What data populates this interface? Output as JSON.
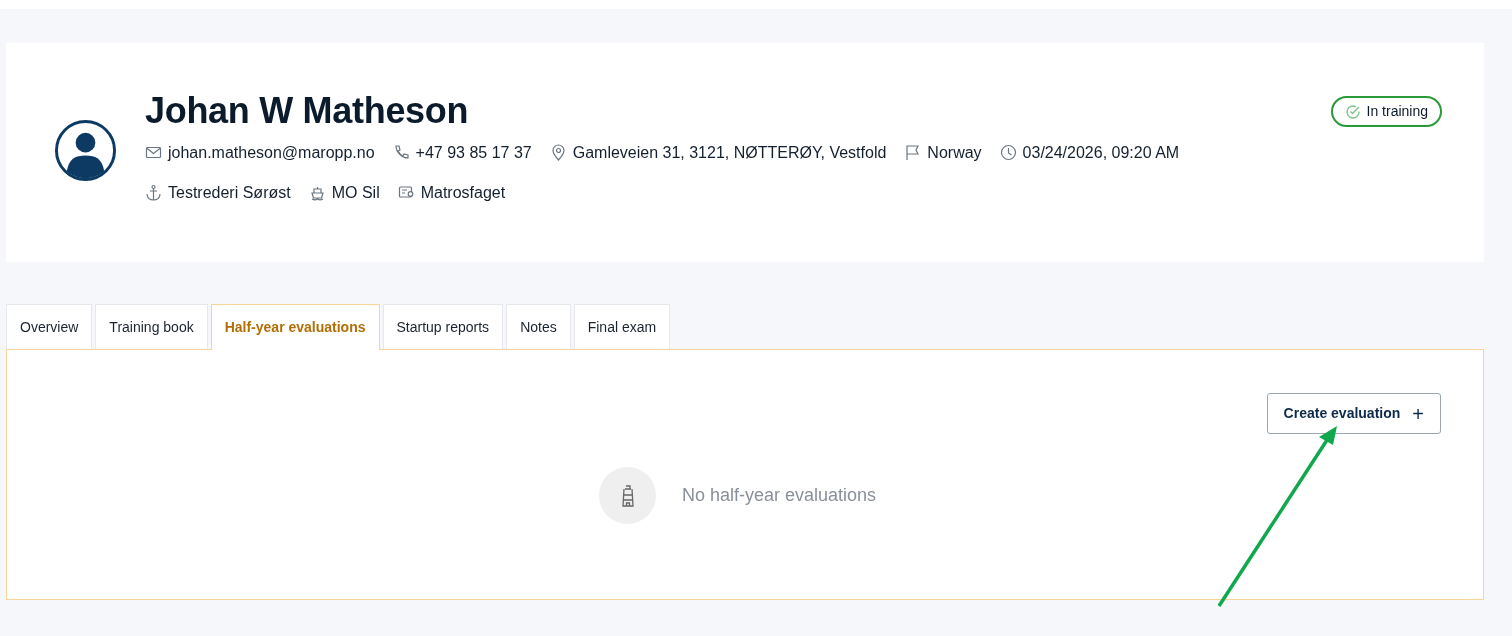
{
  "profile": {
    "name": "Johan W Matheson",
    "status": "In training",
    "details": [
      {
        "kind": "email",
        "text": "johan.matheson@maropp.no"
      },
      {
        "kind": "phone",
        "text": "+47 93 85 17 37"
      },
      {
        "kind": "location",
        "text": "Gamleveien 31, 3121, NØTTERØY, Vestfold"
      },
      {
        "kind": "country",
        "text": "Norway"
      },
      {
        "kind": "time",
        "text": "03/24/2026, 09:20 AM"
      }
    ],
    "affiliations": [
      {
        "kind": "company",
        "text": "Testrederi Sørøst"
      },
      {
        "kind": "vessel",
        "text": "MO Sil"
      },
      {
        "kind": "trade",
        "text": "Matrosfaget"
      }
    ]
  },
  "tabs": [
    {
      "label": "Overview",
      "selected": false
    },
    {
      "label": "Training book",
      "selected": false
    },
    {
      "label": "Half-year evaluations",
      "selected": true
    },
    {
      "label": "Startup reports",
      "selected": false
    },
    {
      "label": "Notes",
      "selected": false
    },
    {
      "label": "Final exam",
      "selected": false
    }
  ],
  "panel": {
    "button": "Create evaluation",
    "button_icon": "+",
    "empty_message": "No half-year evaluations"
  }
}
